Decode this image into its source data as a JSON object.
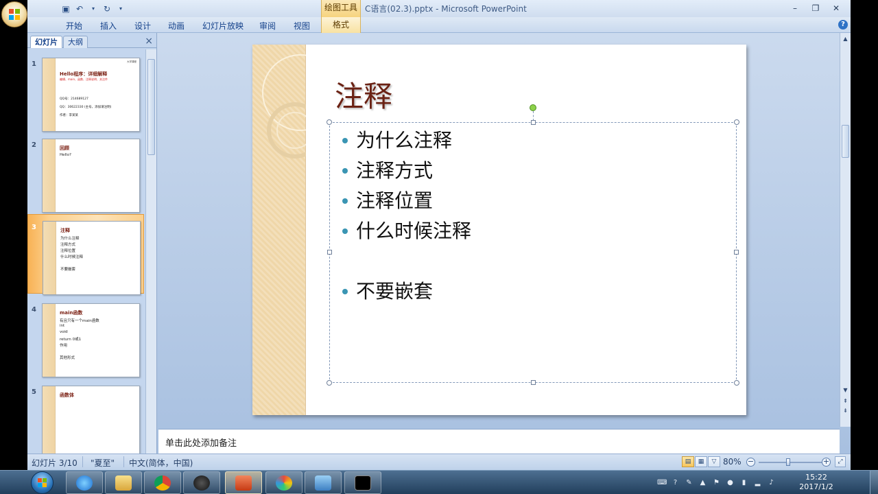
{
  "window": {
    "title": "C语言(02.3).pptx - Microsoft PowerPoint",
    "contextual_tab_group": "绘图工具"
  },
  "ribbon": {
    "tabs": [
      "开始",
      "插入",
      "设计",
      "动画",
      "幻灯片放映",
      "审阅",
      "视图"
    ],
    "contextual_tab": "格式"
  },
  "panel": {
    "tab_slides": "幻灯片",
    "tab_outline": "大纲",
    "close": "×"
  },
  "thumbnails": [
    {
      "num": "1",
      "title": "Hello程序：详细解释",
      "subtitle": "编辑、main、函数、注释说明、关注件",
      "lines": [
        "QQ号：214689127",
        "QQ：30622330 (主号，添加请注明)",
        "作者：李某某"
      ],
      "corner": "大学课程"
    },
    {
      "num": "2",
      "title": "回顾",
      "bullets": [
        "Hello?"
      ]
    },
    {
      "num": "3",
      "title": "注释",
      "bullets": [
        "为什么注释",
        "注释方式",
        "注释位置",
        "什么时候注释",
        "",
        "不要嵌套"
      ]
    },
    {
      "num": "4",
      "title": "main函数",
      "bullets": [
        "有且只有一个main函数",
        "int",
        "void",
        "return 0或1",
        "作用",
        "",
        "其他形式"
      ]
    },
    {
      "num": "5",
      "title": "函数体",
      "bullets": []
    }
  ],
  "slide": {
    "title": "注释",
    "bullets": [
      "为什么注释",
      "注释方式",
      "注释位置",
      "什么时候注释",
      "不要嵌套"
    ]
  },
  "notes": {
    "placeholder": "单击此处添加备注"
  },
  "status": {
    "slide_info": "幻灯片 3/10",
    "theme": "\"夏至\"",
    "language": "中文(简体，中国)",
    "zoom": "80%",
    "zoom_level_pct": 80
  },
  "clock": {
    "time": "15:22",
    "date": "2017/1/2"
  },
  "colors": {
    "slide_title": "#6b2214",
    "bullet": "#3a95b3",
    "selected_thumb": "#f8b255"
  }
}
